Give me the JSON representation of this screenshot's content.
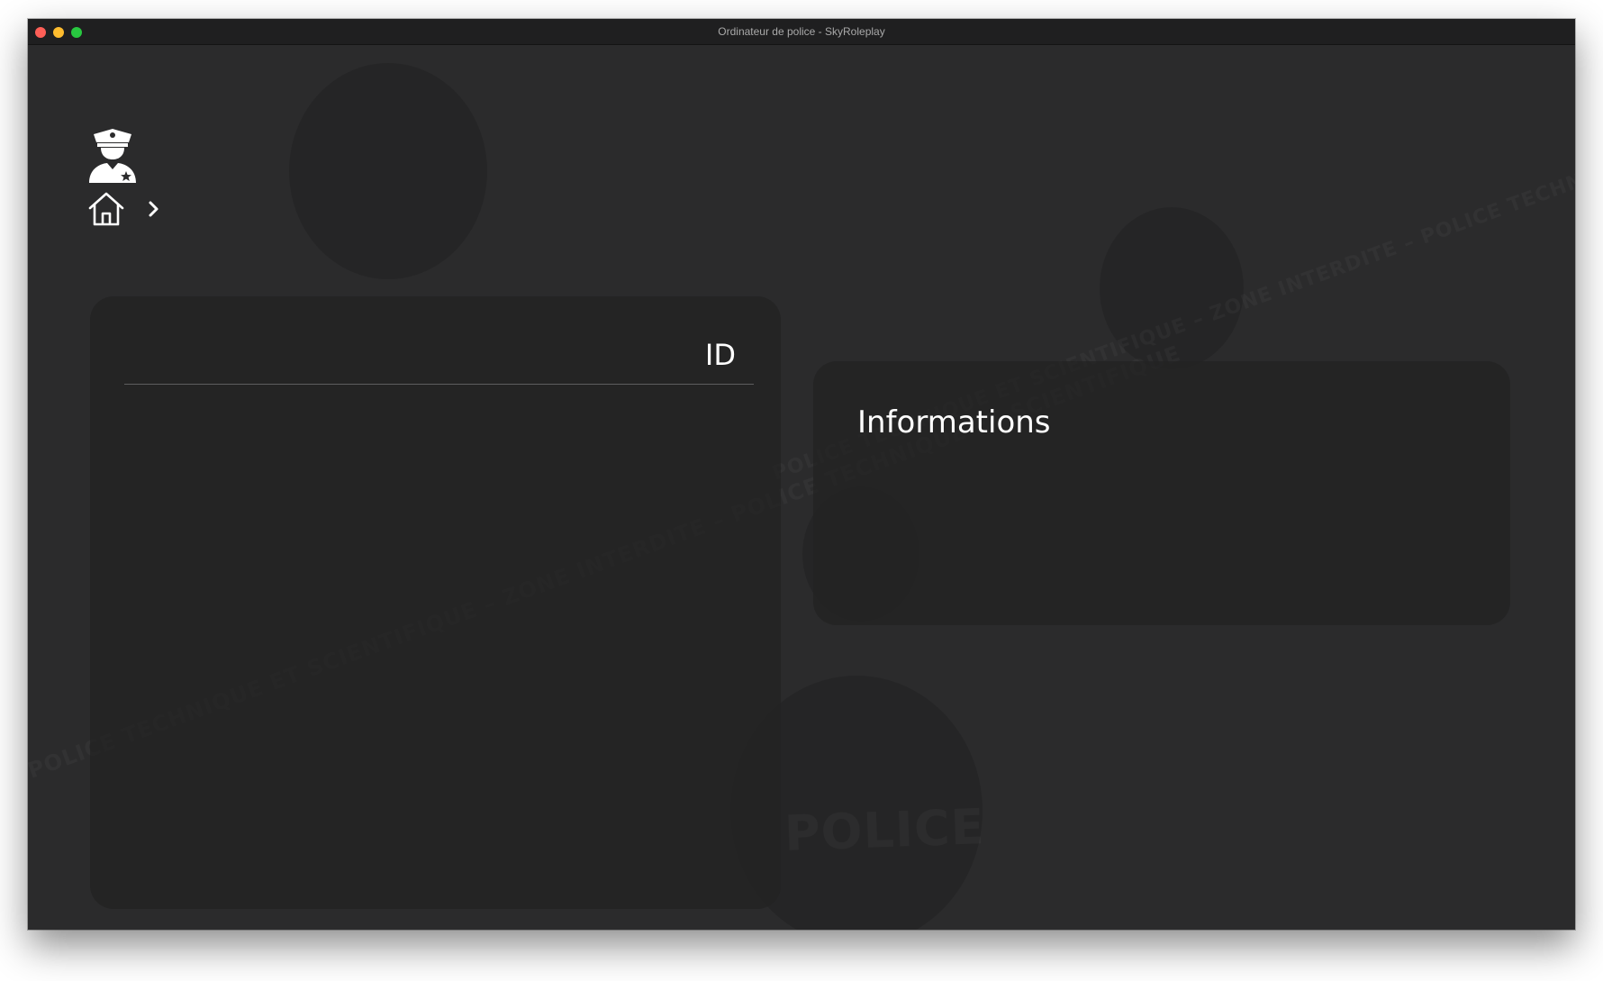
{
  "window": {
    "title": "Ordinateur de police - SkyRoleplay"
  },
  "header": {
    "logo_icon": "police-officer-icon",
    "breadcrumb": {
      "home_icon": "home-icon",
      "separator_icon": "chevron-right-icon"
    }
  },
  "id_panel": {
    "label": "ID"
  },
  "info_panel": {
    "title": "Informations"
  },
  "colors": {
    "background": "#2b2b2c",
    "panel": "#222223",
    "text": "#ffffff",
    "divider": "#5d5d5e",
    "titlebar": "#1f1f20"
  }
}
